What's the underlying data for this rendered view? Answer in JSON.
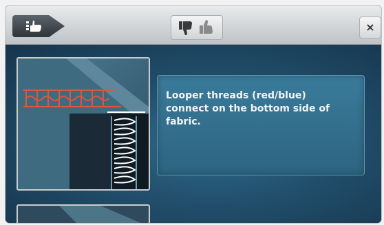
{
  "toolbar": {
    "back_icon": "hand-pointing-icon",
    "rating_icons": [
      "thumbs-down-icon",
      "thumbs-up-icon"
    ],
    "close_label": "×"
  },
  "main": {
    "info_text": "Looper threads (red/blue) connect on the bottom side of fabric."
  },
  "colors": {
    "panel_blue": "#2d6481",
    "background_blue": "#214e6b",
    "stitch_red": "#e0553c",
    "stitch_white": "#ffffff"
  }
}
